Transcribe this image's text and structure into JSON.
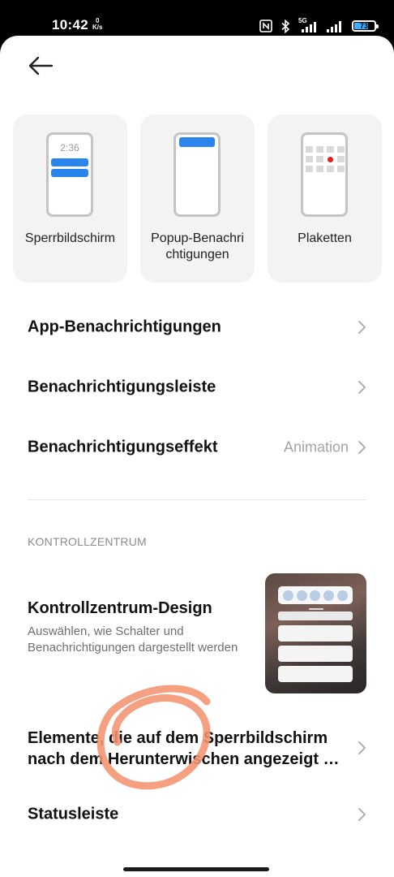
{
  "status_bar": {
    "time": "10:42",
    "speed_value": "0",
    "speed_unit": "K/s",
    "network": "5G",
    "battery": "73",
    "battery_level_percent": 73
  },
  "header": {
    "back_icon": "arrow-left-icon"
  },
  "style_cards": [
    {
      "label": "Sperrbildschirm",
      "preview_time": "2:36"
    },
    {
      "label": "Popup-Benachri chtigungen"
    },
    {
      "label": "Plaketten"
    }
  ],
  "rows": {
    "app_notifications": "App-Benachrichtigungen",
    "notification_bar": "Benachrichtigungsleiste",
    "notification_effect": "Benachrichtigungseffekt",
    "notification_effect_value": "Animation"
  },
  "control_center": {
    "section_header": "KONTROLLZENTRUM",
    "design_title": "Kontrollzentrum-Design",
    "design_subtitle": "Auswählen, wie Schalter und Benachrichtigungen dargestellt werden",
    "lockscreen_items": "Elemente, die auf dem Sperrbildschirm\nnach dem Herunterwischen angezeigt …",
    "status_bar": "Statusleiste"
  },
  "colors": {
    "accent_blue": "#2a84ee",
    "badge_red": "#e51e1e",
    "annotation_orange": "#f29370",
    "chevron_gray": "#b0b0b0"
  }
}
